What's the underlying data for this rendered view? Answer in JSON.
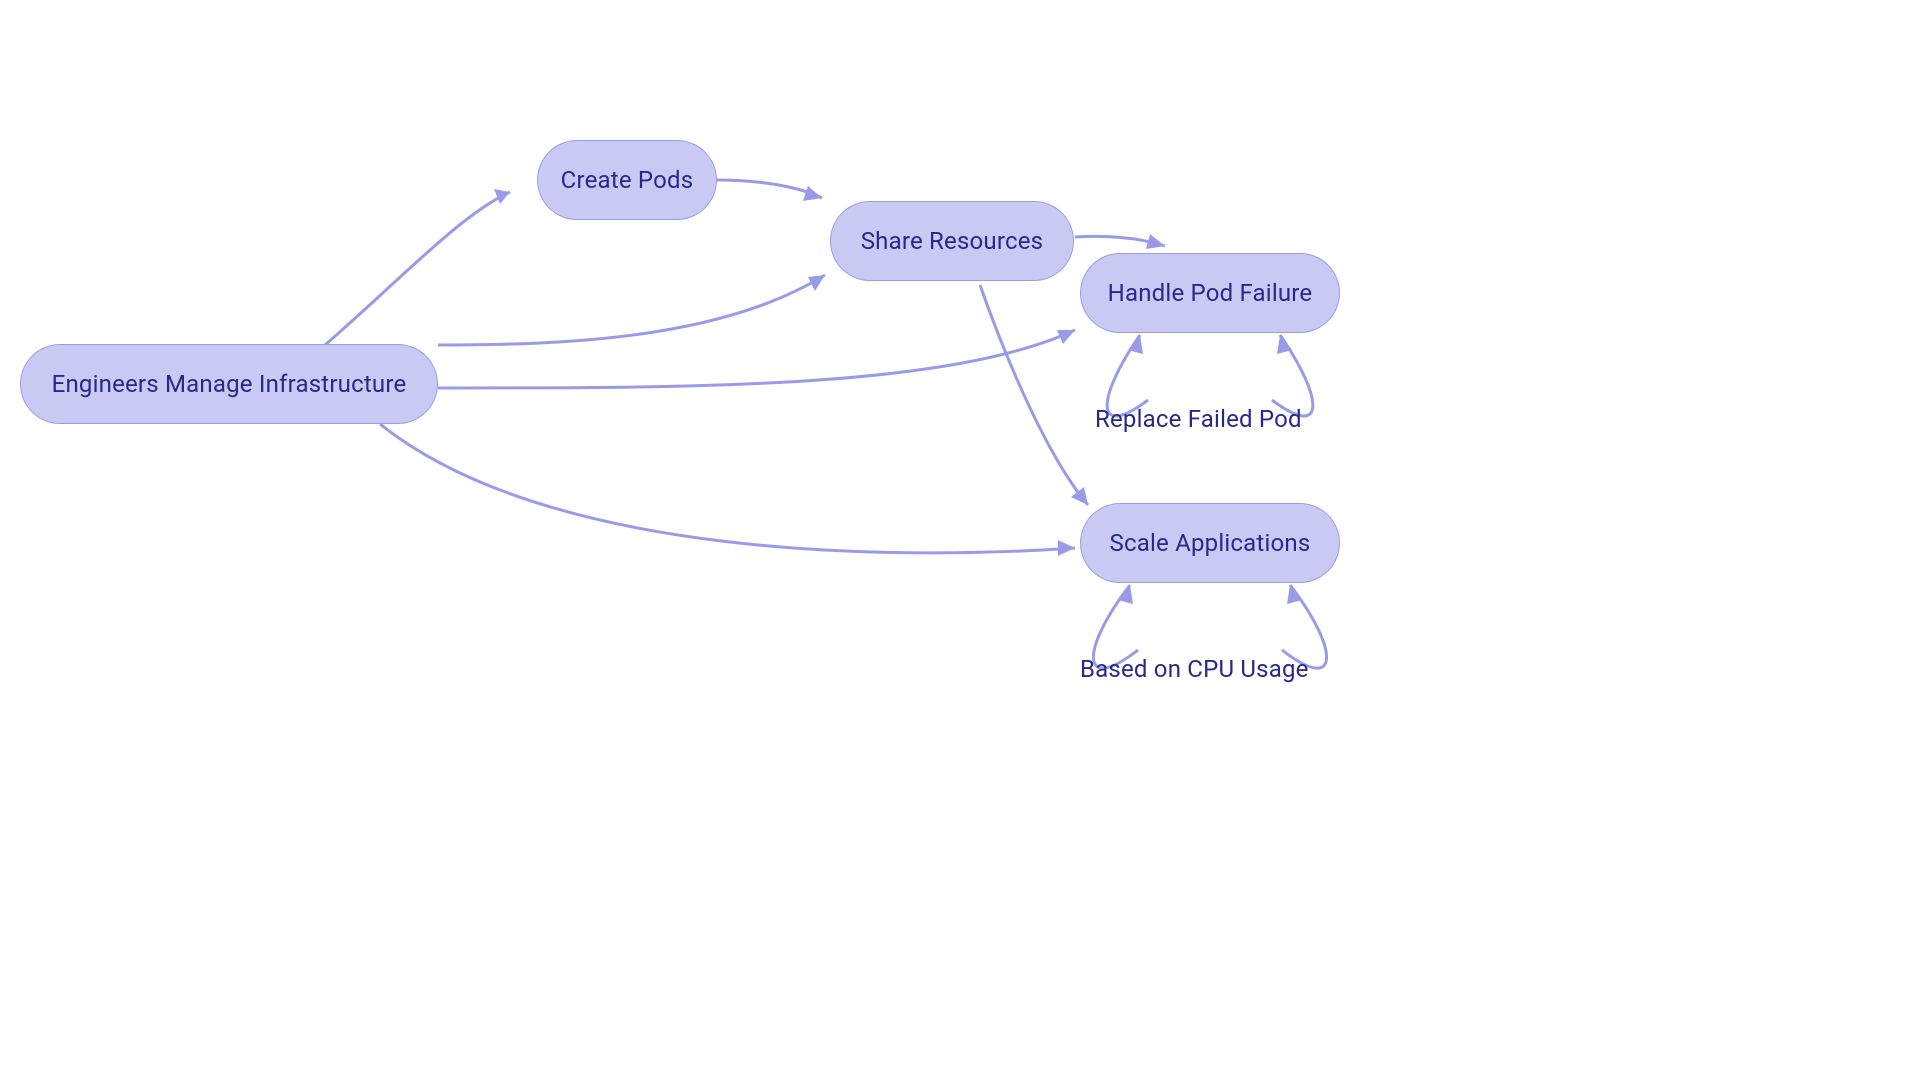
{
  "nodes": {
    "root": {
      "label": "Engineers Manage Infrastructure"
    },
    "create": {
      "label": "Create Pods"
    },
    "share": {
      "label": "Share Resources"
    },
    "handle": {
      "label": "Handle Pod Failure"
    },
    "scale": {
      "label": "Scale Applications"
    }
  },
  "edge_labels": {
    "replace": "Replace Failed Pod",
    "cpu": "Based on CPU Usage"
  },
  "colors": {
    "node_fill": "#c9caf4",
    "node_stroke": "#9a9be8",
    "text": "#28288c",
    "edge": "#9a9be8"
  }
}
